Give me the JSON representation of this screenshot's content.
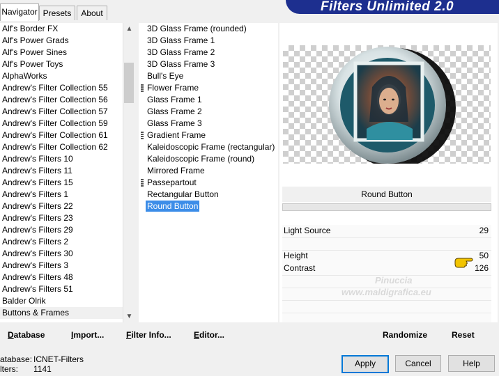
{
  "title_banner": "Filters Unlimited 2.0",
  "tabs": [
    {
      "label": "Navigator",
      "active": true
    },
    {
      "label": "Presets",
      "active": false
    },
    {
      "label": "About",
      "active": false
    }
  ],
  "categories": [
    "Alf's Border FX",
    "Alf's Power Grads",
    "Alf's Power Sines",
    "Alf's Power Toys",
    "AlphaWorks",
    "Andrew's Filter Collection 55",
    "Andrew's Filter Collection 56",
    "Andrew's Filter Collection 57",
    "Andrew's Filter Collection 59",
    "Andrew's Filter Collection 61",
    "Andrew's Filter Collection 62",
    "Andrew's Filters 10",
    "Andrew's Filters 11",
    "Andrew's Filters 15",
    "Andrew's Filters 1",
    "Andrew's Filters 22",
    "Andrew's Filters 23",
    "Andrew's Filters 29",
    "Andrew's Filters 2",
    "Andrew's Filters 30",
    "Andrew's Filters 3",
    "Andrew's Filters 48",
    "Andrew's Filters 51",
    "Balder Olrik",
    "Buttons & Frames"
  ],
  "selected_category": "Buttons & Frames",
  "filters": [
    {
      "label": "3D Glass Frame (rounded)",
      "marked": false
    },
    {
      "label": "3D Glass Frame 1",
      "marked": false
    },
    {
      "label": "3D Glass Frame 2",
      "marked": false
    },
    {
      "label": "3D Glass Frame 3",
      "marked": false
    },
    {
      "label": "Bull's Eye",
      "marked": false
    },
    {
      "label": "Flower Frame",
      "marked": true
    },
    {
      "label": "Glass Frame 1",
      "marked": false
    },
    {
      "label": "Glass Frame 2",
      "marked": false
    },
    {
      "label": "Glass Frame 3",
      "marked": false
    },
    {
      "label": "Gradient Frame",
      "marked": true
    },
    {
      "label": "Kaleidoscopic Frame (rectangular)",
      "marked": false
    },
    {
      "label": "Kaleidoscopic Frame (round)",
      "marked": false
    },
    {
      "label": "Mirrored Frame",
      "marked": false
    },
    {
      "label": "Passepartout",
      "marked": true
    },
    {
      "label": "Rectangular Button",
      "marked": false
    },
    {
      "label": "Round Button",
      "marked": false,
      "selected": true
    }
  ],
  "filter_title": "Round Button",
  "params": [
    {
      "label": "Light Source",
      "value": "29"
    },
    {
      "label": "Height",
      "value": "50"
    },
    {
      "label": "Contrast",
      "value": "126"
    }
  ],
  "bottom_left": {
    "database": {
      "u": "D",
      "rest": "atabase"
    },
    "import": {
      "u": "I",
      "rest": "mport..."
    },
    "filter_info": {
      "u": "F",
      "rest": "ilter Info..."
    },
    "editor": {
      "u": "E",
      "rest": "ditor..."
    }
  },
  "bottom_right": {
    "randomize": "Randomize",
    "reset": "Reset"
  },
  "status": {
    "database_label": "atabase:",
    "database_value": "ICNET-Filters",
    "filters_label": "lters:",
    "filters_value": "1141"
  },
  "buttons": {
    "apply": "Apply",
    "cancel": "Cancel",
    "help": "Help"
  },
  "watermark": {
    "name": "Pinuccia",
    "site": "www.maldigrafica.eu"
  },
  "colors": {
    "banner": "#1d2f8f",
    "selection": "#3c8de8",
    "default_button_border": "#0078d7"
  }
}
